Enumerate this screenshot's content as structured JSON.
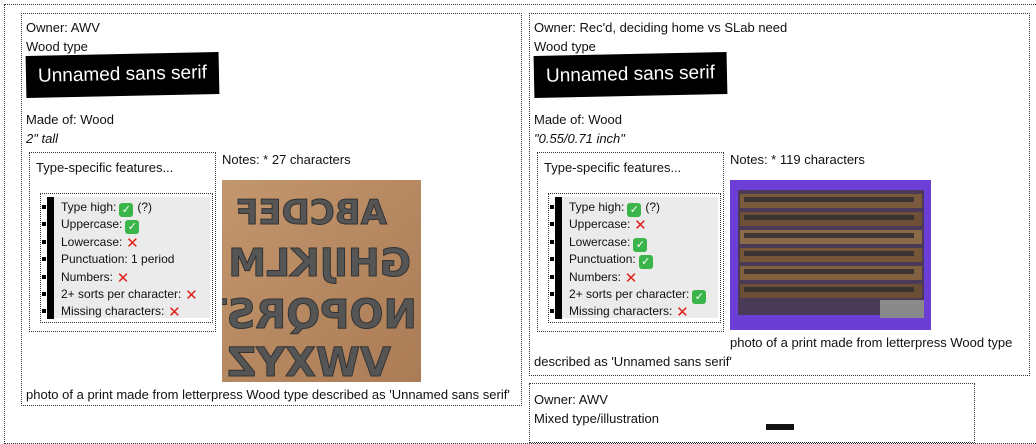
{
  "cards": [
    {
      "owner": "Owner: AWV",
      "category": "Wood type",
      "title": "Unnamed sans serif",
      "made_of": "Made of: Wood",
      "size": "2\" tall",
      "features_title": "Type-specific features...",
      "features": [
        {
          "label": "Type high:",
          "badge": "check-icon",
          "extra": "(?)"
        },
        {
          "label": "Uppercase:",
          "badge": "check-icon",
          "extra": ""
        },
        {
          "label": "Lowercase:",
          "badge": "cross-icon",
          "extra": ""
        },
        {
          "label": "Punctuation: 1 period",
          "badge": "",
          "extra": ""
        },
        {
          "label": "Numbers:",
          "badge": "cross-icon",
          "extra": ""
        },
        {
          "label": "2+ sorts per character:",
          "badge": "cross-icon",
          "extra": ""
        },
        {
          "label": "Missing characters:",
          "badge": "cross-icon",
          "extra": ""
        }
      ],
      "notes": "Notes: * 27 characters",
      "caption": "photo of a print made from letterpress Wood type described as 'Unnamed sans serif'"
    },
    {
      "owner": "Owner: Rec'd, deciding home vs SLab need",
      "category": "Wood type",
      "title": "Unnamed sans serif",
      "made_of": "Made of: Wood",
      "size": "\"0.55/0.71 inch\"",
      "features_title": "Type-specific features...",
      "features": [
        {
          "label": "Type high:",
          "badge": "check-icon",
          "extra": "(?)"
        },
        {
          "label": "Uppercase:",
          "badge": "cross-icon",
          "extra": ""
        },
        {
          "label": "Lowercase:",
          "badge": "check-icon",
          "extra": ""
        },
        {
          "label": "Punctuation:",
          "badge": "check-icon",
          "extra": ""
        },
        {
          "label": "Numbers:",
          "badge": "cross-icon",
          "extra": ""
        },
        {
          "label": "2+ sorts per character:",
          "badge": "check-icon",
          "extra": ""
        },
        {
          "label": "Missing characters:",
          "badge": "cross-icon",
          "extra": ""
        }
      ],
      "notes": "Notes: * 119 characters",
      "caption_line1": "photo of a print made from letterpress Wood type",
      "caption_line2": "described as 'Unnamed sans serif'"
    },
    {
      "owner": "Owner: AWV",
      "category": "Mixed type/illustration"
    }
  ],
  "colors": {
    "check": "#39b54a",
    "cross": "#e0201b",
    "photo2_bg": "#6b3fd6",
    "photo1_bg": "#b98a62"
  }
}
